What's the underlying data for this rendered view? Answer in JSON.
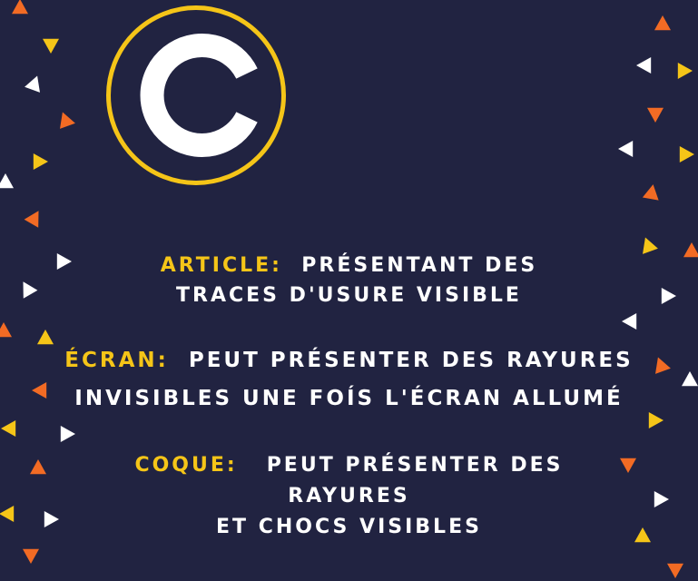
{
  "colors": {
    "background": "#212341",
    "accent": "#f5c518",
    "text": "#ffffff",
    "orange": "#f26b24",
    "yellow": "#f5c518",
    "white": "#ffffff"
  },
  "logo": {
    "icon": "copyright-c-icon",
    "letter": "C"
  },
  "sections": [
    {
      "key": "ARTICLE:",
      "lines": [
        "PRÉSENTANT DES",
        "TRACES D'USURE VISIBLE"
      ]
    },
    {
      "key": "ÉCRAN:",
      "lines": [
        "PEUT PRÉSENTER DES RAYURES",
        "INVISIBLES UNE FOÍS L'ÉCRAN ALLUMÉ"
      ]
    },
    {
      "key": "COQUE:",
      "lines": [
        "PEUT PRÉSENTER DES",
        "RAYURES",
        "ET CHOCS VISIBLES"
      ]
    }
  ]
}
